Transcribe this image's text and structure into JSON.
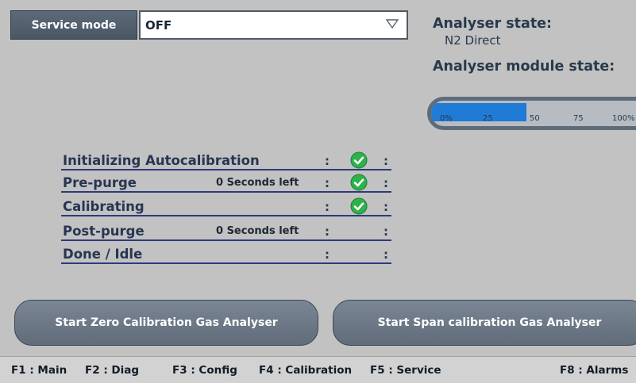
{
  "service_mode": {
    "label": "Service mode",
    "value": "OFF"
  },
  "analyser": {
    "state_title": "Analyser state:",
    "state_value": "N2 Direct",
    "module_state_title": "Analyser module state:"
  },
  "gauge": {
    "ticks": [
      "0%",
      "25",
      "50",
      "75",
      "100%"
    ],
    "progress_percent": 43,
    "fill_color": "#1f7bd6"
  },
  "steps": [
    {
      "label": "Initializing Autocalibration",
      "seconds": "",
      "colon1": ":",
      "colon2": ":",
      "done": true
    },
    {
      "label": "Pre-purge",
      "seconds": "0 Seconds left",
      "colon1": ":",
      "colon2": ":",
      "done": true
    },
    {
      "label": "Calibrating",
      "seconds": "",
      "colon1": ":",
      "colon2": ":",
      "done": true
    },
    {
      "label": "Post-purge",
      "seconds": "0 Seconds left",
      "colon1": ":",
      "colon2": ":",
      "done": false
    },
    {
      "label": "Done / Idle",
      "seconds": "",
      "colon1": ":",
      "colon2": ":",
      "done": false
    }
  ],
  "buttons": {
    "zero": "Start Zero Calibration Gas Analyser",
    "span": "Start Span calibration Gas Analyser"
  },
  "function_keys": [
    {
      "label": "F1 : Main"
    },
    {
      "label": "F2 : Diag"
    },
    {
      "label": "F3 : Config"
    },
    {
      "label": "F4 : Calibration"
    },
    {
      "label": "F5 : Service"
    },
    {
      "label": "F8 : Alarms"
    }
  ],
  "colors": {
    "background": "#c2c2c2",
    "check_green": "#2db34a",
    "underline": "#2d3a7a"
  }
}
